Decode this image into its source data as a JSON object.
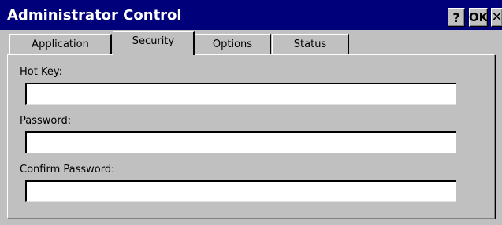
{
  "window": {
    "title": "Administrator Control",
    "help_label": "?",
    "ok_label": "OK",
    "close_label": "✕"
  },
  "tabs": [
    {
      "label": "Application",
      "active": false
    },
    {
      "label": "Security",
      "active": true
    },
    {
      "label": "Options",
      "active": false
    },
    {
      "label": "Status",
      "active": false
    }
  ],
  "security": {
    "hot_key": {
      "label": "Hot Key:",
      "value": ""
    },
    "password": {
      "label": "Password:",
      "value": ""
    },
    "confirm_password": {
      "label": "Confirm Password:",
      "value": ""
    }
  }
}
